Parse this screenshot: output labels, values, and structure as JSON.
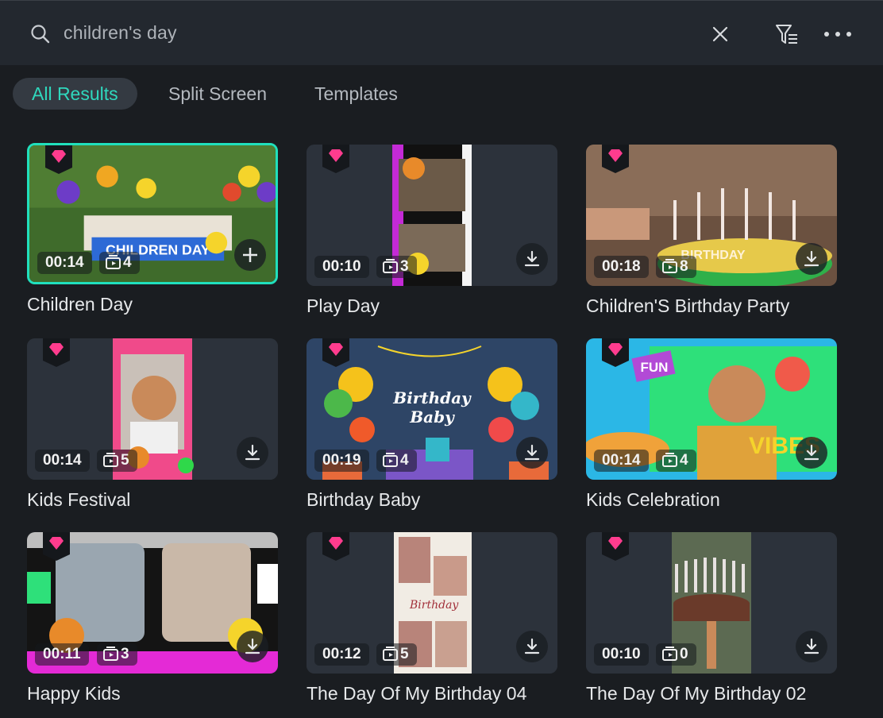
{
  "search": {
    "query": "children's day",
    "icons": {
      "search": "search-icon",
      "clear": "close-icon",
      "filter": "filter-icon",
      "more": "more-icon"
    }
  },
  "tabs": [
    {
      "label": "All Results",
      "active": true
    },
    {
      "label": "Split Screen",
      "active": false
    },
    {
      "label": "Templates",
      "active": false
    }
  ],
  "templates": [
    {
      "title": "Children Day",
      "duration": "00:14",
      "clips": "4",
      "action": "add",
      "premium": true,
      "selected": true
    },
    {
      "title": "Play Day",
      "duration": "00:10",
      "clips": "3",
      "action": "download",
      "premium": true
    },
    {
      "title": "Children'S Birthday Party",
      "duration": "00:18",
      "clips": "8",
      "action": "download",
      "premium": true
    },
    {
      "title": "Kids Festival",
      "duration": "00:14",
      "clips": "5",
      "action": "download",
      "premium": true
    },
    {
      "title": "Birthday Baby",
      "duration": "00:19",
      "clips": "4",
      "action": "download",
      "premium": true,
      "art_text": [
        "Birthday",
        "Baby"
      ]
    },
    {
      "title": "Kids Celebration",
      "duration": "00:14",
      "clips": "4",
      "action": "download",
      "premium": true,
      "art_text": [
        "FUN",
        "VIBES"
      ]
    },
    {
      "title": "Happy Kids",
      "duration": "00:11",
      "clips": "3",
      "action": "download",
      "premium": true
    },
    {
      "title": "The Day Of My Birthday 04",
      "duration": "00:12",
      "clips": "5",
      "action": "download",
      "premium": true,
      "art_text": [
        "Birthday"
      ]
    },
    {
      "title": "The Day Of My Birthday 02",
      "duration": "00:10",
      "clips": "0",
      "action": "download",
      "premium": true
    }
  ],
  "first_art_text": "CHILDREN DAY",
  "third_art_text": "BIRTHDAY",
  "colors": {
    "accent": "#20e0bd",
    "premium_gem": "#ff3c8e",
    "background": "#1a1d21",
    "card": "#2c323b"
  }
}
